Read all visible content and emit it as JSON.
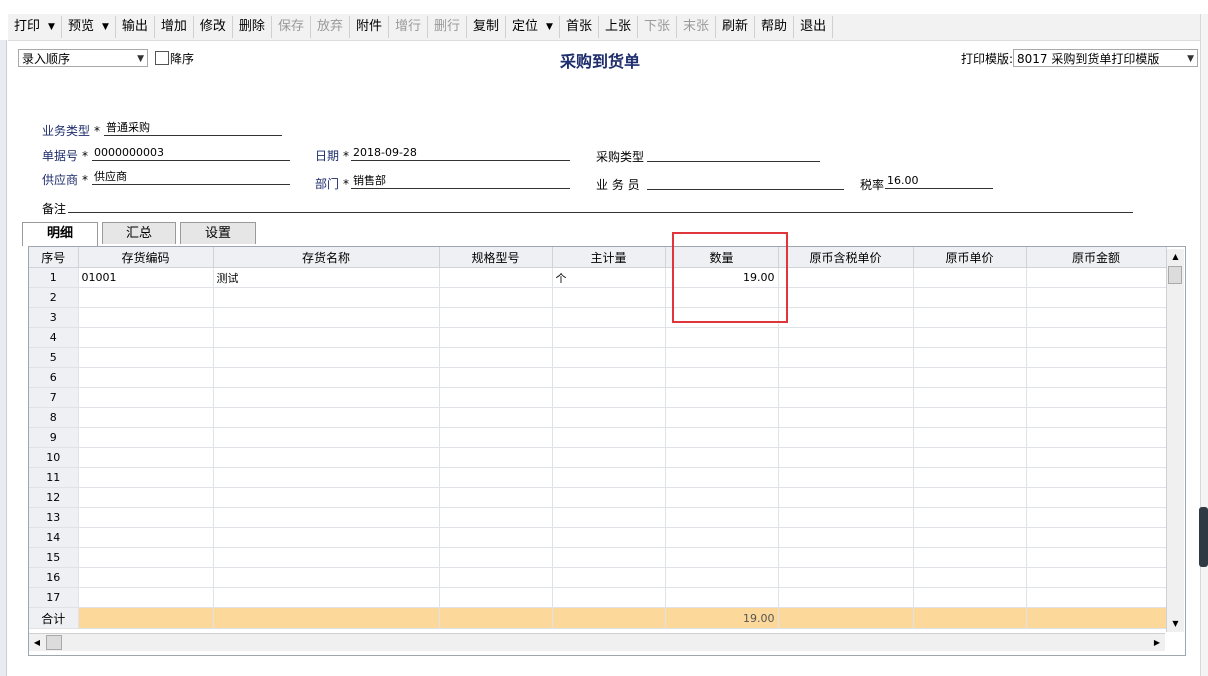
{
  "toolbar": {
    "buttons": [
      {
        "label": "打印",
        "dropdown": true,
        "enabled": true
      },
      {
        "label": "预览",
        "dropdown": true,
        "enabled": true
      },
      {
        "label": "输出",
        "dropdown": false,
        "enabled": true
      },
      {
        "label": "增加",
        "dropdown": false,
        "enabled": true
      },
      {
        "label": "修改",
        "dropdown": false,
        "enabled": true
      },
      {
        "label": "删除",
        "dropdown": false,
        "enabled": true
      },
      {
        "label": "保存",
        "dropdown": false,
        "enabled": false
      },
      {
        "label": "放弃",
        "dropdown": false,
        "enabled": false
      },
      {
        "label": "附件",
        "dropdown": false,
        "enabled": true
      },
      {
        "label": "增行",
        "dropdown": false,
        "enabled": false
      },
      {
        "label": "删行",
        "dropdown": false,
        "enabled": false
      },
      {
        "label": "复制",
        "dropdown": false,
        "enabled": true
      },
      {
        "label": "定位",
        "dropdown": true,
        "enabled": true
      },
      {
        "label": "首张",
        "dropdown": false,
        "enabled": true
      },
      {
        "label": "上张",
        "dropdown": false,
        "enabled": true
      },
      {
        "label": "下张",
        "dropdown": false,
        "enabled": false
      },
      {
        "label": "末张",
        "dropdown": false,
        "enabled": false
      },
      {
        "label": "刷新",
        "dropdown": false,
        "enabled": true
      },
      {
        "label": "帮助",
        "dropdown": false,
        "enabled": true
      },
      {
        "label": "退出",
        "dropdown": false,
        "enabled": true
      }
    ]
  },
  "sort": {
    "select_value": "录入顺序",
    "desc_label": "降序",
    "desc_checked": false
  },
  "title": "采购到货单",
  "print_template": {
    "label": "打印模版:",
    "value": "8017 采购到货单打印模版"
  },
  "form": {
    "biz_type": {
      "label": "业务类型",
      "required": "*",
      "value": "普通采购"
    },
    "doc_no": {
      "label": "单据号",
      "required": "*",
      "value": "0000000003"
    },
    "date": {
      "label": "日期",
      "required": "*",
      "value": "2018-09-28"
    },
    "purchase_type": {
      "label": "采购类型",
      "value": ""
    },
    "supplier": {
      "label": "供应商",
      "required": "*",
      "value": "供应商"
    },
    "department": {
      "label": "部门",
      "required": "*",
      "value": "销售部"
    },
    "salesman": {
      "label": "业 务 员",
      "value": ""
    },
    "tax_rate": {
      "label": "税率",
      "value": "16.00"
    },
    "remark": {
      "label": "备注",
      "value": ""
    }
  },
  "tabs": [
    {
      "label": "明细",
      "active": true
    },
    {
      "label": "汇总",
      "active": false
    },
    {
      "label": "设置",
      "active": false
    }
  ],
  "grid": {
    "columns": [
      "序号",
      "存货编码",
      "存货名称",
      "规格型号",
      "主计量",
      "数量",
      "原币含税单价",
      "原币单价",
      "原币金额"
    ],
    "rows": [
      [
        "1",
        "01001",
        "测试",
        "",
        "个",
        "19.00",
        "",
        "",
        ""
      ],
      [
        "2",
        "",
        "",
        "",
        "",
        "",
        "",
        "",
        ""
      ],
      [
        "3",
        "",
        "",
        "",
        "",
        "",
        "",
        "",
        ""
      ],
      [
        "4",
        "",
        "",
        "",
        "",
        "",
        "",
        "",
        ""
      ],
      [
        "5",
        "",
        "",
        "",
        "",
        "",
        "",
        "",
        ""
      ],
      [
        "6",
        "",
        "",
        "",
        "",
        "",
        "",
        "",
        ""
      ],
      [
        "7",
        "",
        "",
        "",
        "",
        "",
        "",
        "",
        ""
      ],
      [
        "8",
        "",
        "",
        "",
        "",
        "",
        "",
        "",
        ""
      ],
      [
        "9",
        "",
        "",
        "",
        "",
        "",
        "",
        "",
        ""
      ],
      [
        "10",
        "",
        "",
        "",
        "",
        "",
        "",
        "",
        ""
      ],
      [
        "11",
        "",
        "",
        "",
        "",
        "",
        "",
        "",
        ""
      ],
      [
        "12",
        "",
        "",
        "",
        "",
        "",
        "",
        "",
        ""
      ],
      [
        "13",
        "",
        "",
        "",
        "",
        "",
        "",
        "",
        ""
      ],
      [
        "14",
        "",
        "",
        "",
        "",
        "",
        "",
        "",
        ""
      ],
      [
        "15",
        "",
        "",
        "",
        "",
        "",
        "",
        "",
        ""
      ],
      [
        "16",
        "",
        "",
        "",
        "",
        "",
        "",
        "",
        ""
      ],
      [
        "17",
        "",
        "",
        "",
        "",
        "",
        "",
        "",
        ""
      ]
    ],
    "total": {
      "label": "合计",
      "quantity": "19.00"
    }
  },
  "colors": {
    "title": "#1e2d6b",
    "total_row": "#fcd89a",
    "highlight": "#e0353b",
    "header_bg": "#eef0f3"
  }
}
